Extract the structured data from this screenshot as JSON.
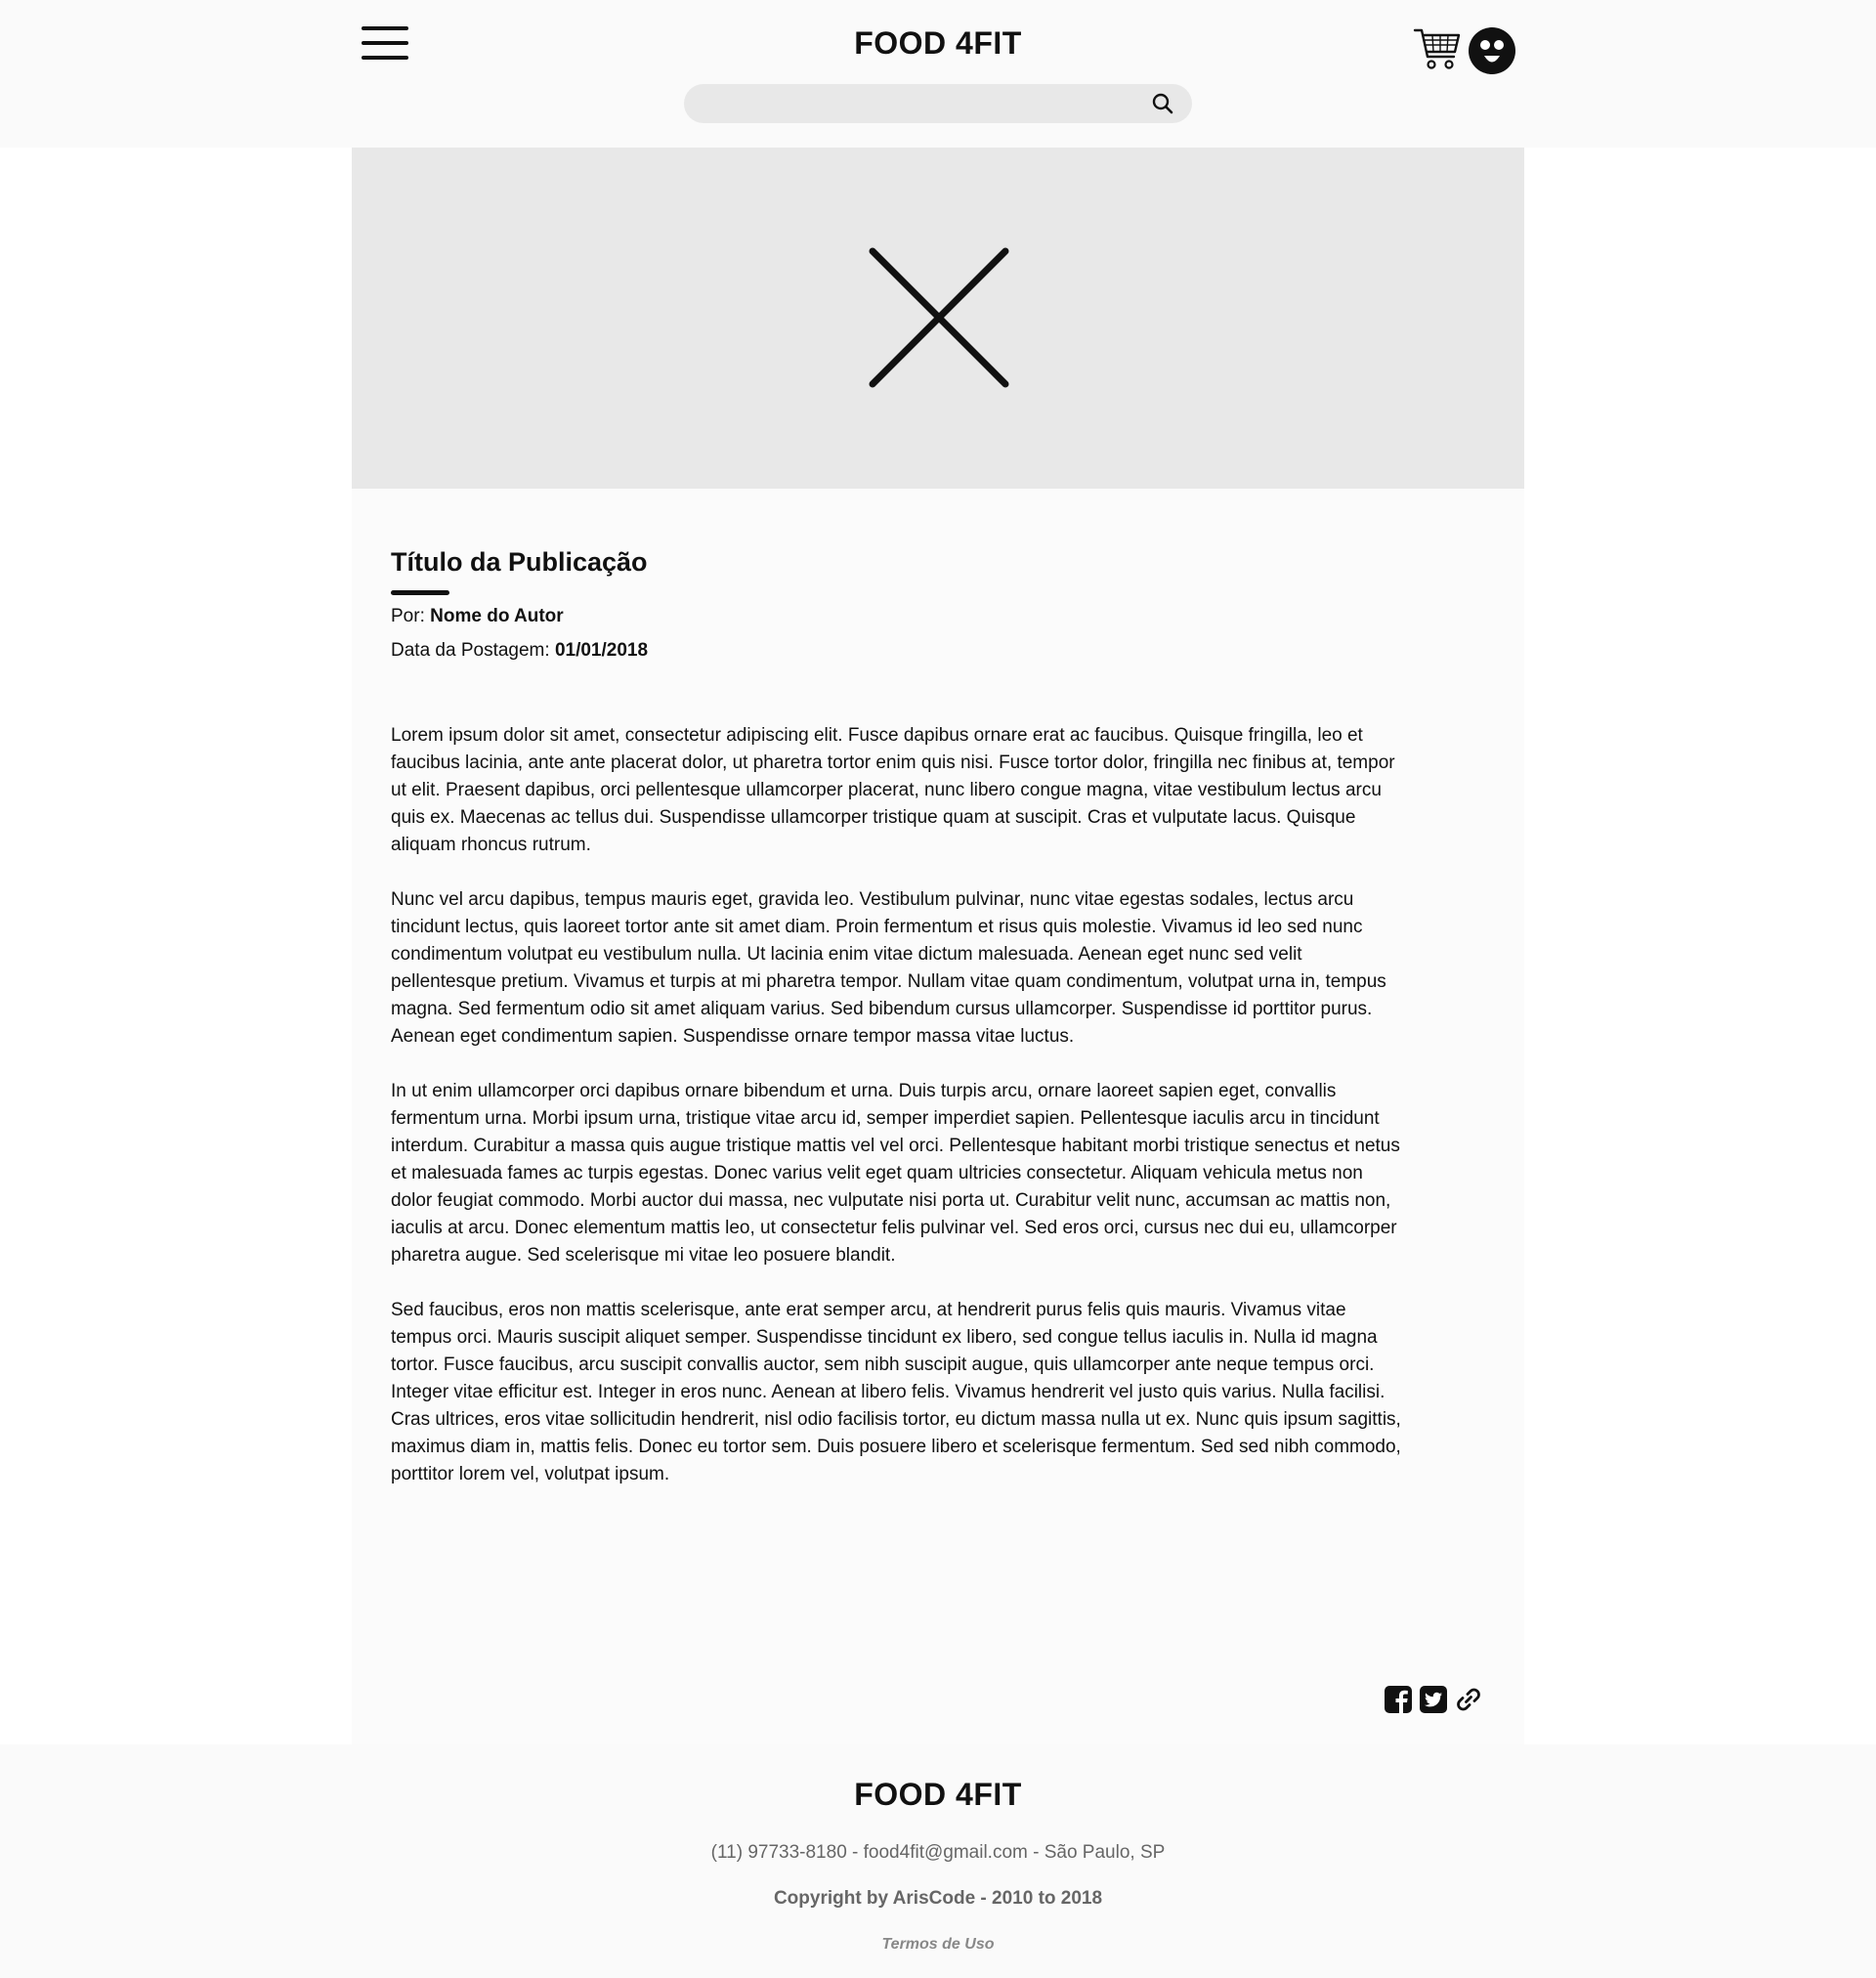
{
  "header": {
    "brand": "FOOD 4FIT",
    "search": {
      "value": "",
      "placeholder": ""
    },
    "icons": {
      "menu": "hamburger-menu-icon",
      "search": "search-icon",
      "cart": "cart-icon",
      "avatar": "user-avatar-icon"
    }
  },
  "hero": {
    "placeholder_icon": "image-placeholder-x-icon"
  },
  "article": {
    "title": "Título da Publicação",
    "author_label": "Por:",
    "author_name": "Nome do Autor",
    "date_label": "Data da Postagem:",
    "date_value": "01/01/2018",
    "paragraphs": [
      "Lorem ipsum dolor sit amet, consectetur adipiscing elit. Fusce dapibus ornare erat ac faucibus. Quisque fringilla, leo et faucibus lacinia, ante ante placerat dolor, ut pharetra tortor enim quis nisi. Fusce tortor dolor, fringilla nec finibus at, tempor ut elit. Praesent dapibus, orci pellentesque ullamcorper placerat, nunc libero congue magna, vitae vestibulum lectus arcu quis ex. Maecenas ac tellus dui. Suspendisse ullamcorper tristique quam at suscipit. Cras et vulputate lacus. Quisque aliquam rhoncus rutrum.",
      "Nunc vel arcu dapibus, tempus mauris eget, gravida leo. Vestibulum pulvinar, nunc vitae egestas sodales, lectus arcu tincidunt lectus, quis laoreet tortor ante sit amet diam. Proin fermentum et risus quis molestie. Vivamus id leo sed nunc condimentum volutpat eu vestibulum nulla. Ut lacinia enim vitae dictum malesuada. Aenean eget nunc sed velit pellentesque pretium. Vivamus et turpis at mi pharetra tempor. Nullam vitae quam condimentum, volutpat urna in, tempus magna. Sed fermentum odio sit amet aliquam varius. Sed bibendum cursus ullamcorper. Suspendisse id porttitor purus. Aenean eget condimentum sapien. Suspendisse ornare tempor massa vitae luctus.",
      "In ut enim ullamcorper orci dapibus ornare bibendum et urna. Duis turpis arcu, ornare laoreet sapien eget, convallis fermentum urna. Morbi ipsum urna, tristique vitae arcu id, semper imperdiet sapien. Pellentesque iaculis arcu in tincidunt interdum. Curabitur a massa quis augue tristique mattis vel vel orci. Pellentesque habitant morbi tristique senectus et netus et malesuada fames ac turpis egestas. Donec varius velit eget quam ultricies consectetur. Aliquam vehicula metus non dolor feugiat commodo. Morbi auctor dui massa, nec vulputate nisi porta ut. Curabitur velit nunc, accumsan ac mattis non, iaculis at arcu. Donec elementum mattis leo, ut consectetur felis pulvinar vel. Sed eros orci, cursus nec dui eu, ullamcorper pharetra augue. Sed scelerisque mi vitae leo posuere blandit.",
      "Sed faucibus, eros non mattis scelerisque, ante erat semper arcu, at hendrerit purus felis quis mauris. Vivamus vitae tempus orci. Mauris suscipit aliquet semper. Suspendisse tincidunt ex libero, sed congue tellus iaculis in. Nulla id magna tortor. Fusce faucibus, arcu suscipit convallis auctor, sem nibh suscipit augue, quis ullamcorper ante neque tempus orci. Integer vitae efficitur est. Integer in eros nunc. Aenean at libero felis. Vivamus hendrerit vel justo quis varius. Nulla facilisi. Cras ultrices, eros vitae sollicitudin hendrerit, nisl odio facilisis tortor, eu dictum massa nulla ut ex. Nunc quis ipsum sagittis, maximus diam in, mattis felis. Donec eu tortor sem. Duis posuere libero et scelerisque fermentum. Sed sed nibh commodo, porttitor lorem vel, volutpat ipsum."
    ],
    "share_icons": [
      "facebook-icon",
      "twitter-icon",
      "link-icon"
    ]
  },
  "footer": {
    "brand": "FOOD 4FIT",
    "contact": "(11) 97733-8180 - food4fit@gmail.com - São Paulo, SP",
    "copyright": "Copyright by ArisCode - 2010 to 2018",
    "terms": "Termos de Uso"
  },
  "colors": {
    "header_bg": "#fafafa",
    "hero_bg": "#e8e8e8",
    "text": "#111111",
    "muted": "#666666"
  }
}
